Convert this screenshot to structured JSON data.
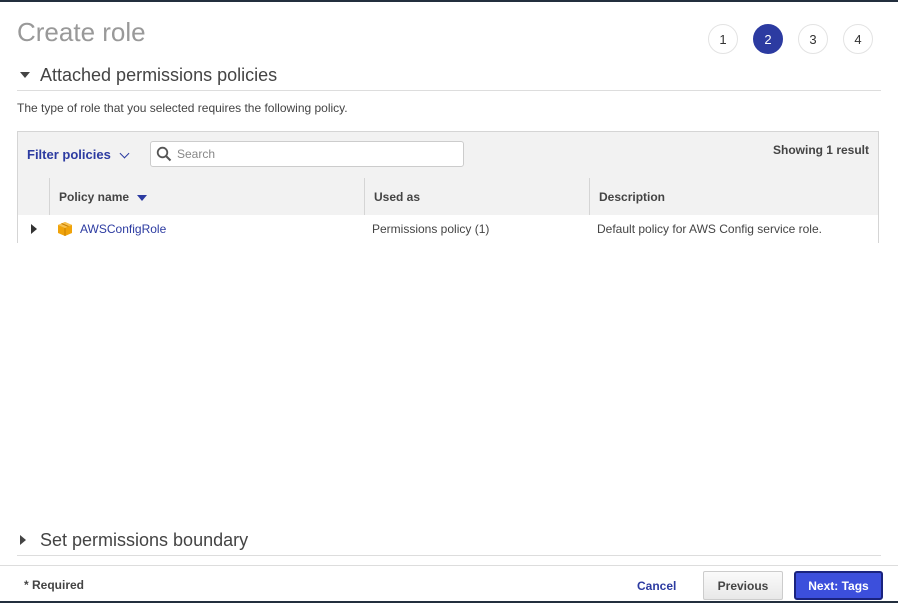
{
  "page": {
    "title": "Create role"
  },
  "steps": [
    {
      "label": "1",
      "active": false
    },
    {
      "label": "2",
      "active": true
    },
    {
      "label": "3",
      "active": false
    },
    {
      "label": "4",
      "active": false
    }
  ],
  "attached": {
    "title": "Attached permissions policies",
    "description": "The type of role that you selected requires the following policy.",
    "filter_label": "Filter policies",
    "search_placeholder": "Search",
    "showing": "Showing 1 result",
    "columns": {
      "policy_name": "Policy name",
      "used_as": "Used as",
      "description": "Description"
    },
    "rows": [
      {
        "policy_name": "AWSConfigRole",
        "used_as": "Permissions policy (1)",
        "description": "Default policy for AWS Config service role."
      }
    ]
  },
  "boundary": {
    "title": "Set permissions boundary"
  },
  "footer": {
    "required": "* Required",
    "cancel": "Cancel",
    "previous": "Previous",
    "next": "Next: Tags"
  },
  "colors": {
    "accent": "#2c3ba1",
    "primary_button": "#3c4fdc",
    "policy_icon": "#f0a30a"
  },
  "icons": {
    "search": "search-icon",
    "policy": "policy-box-icon"
  }
}
